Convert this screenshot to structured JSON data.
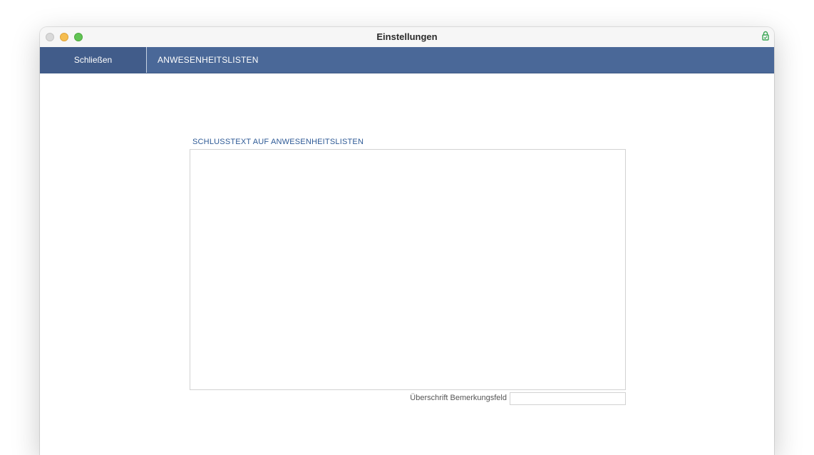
{
  "window": {
    "title": "Einstellungen"
  },
  "toolbar": {
    "close_label": "Schließen",
    "section_title": "ANWESENHEITSLISTEN"
  },
  "form": {
    "closing_text_label": "SCHLUSSTEXT AUF ANWESENHEITSLISTEN",
    "closing_text_value": "",
    "remark_heading_label": "Überschrift Bemerkungsfeld",
    "remark_heading_value": ""
  },
  "colors": {
    "toolbar_background": "#4a6898",
    "accent_text": "#2e5a96",
    "lock_icon": "#3aa655"
  },
  "icons": {
    "titlebar_status": "lock-icon"
  }
}
